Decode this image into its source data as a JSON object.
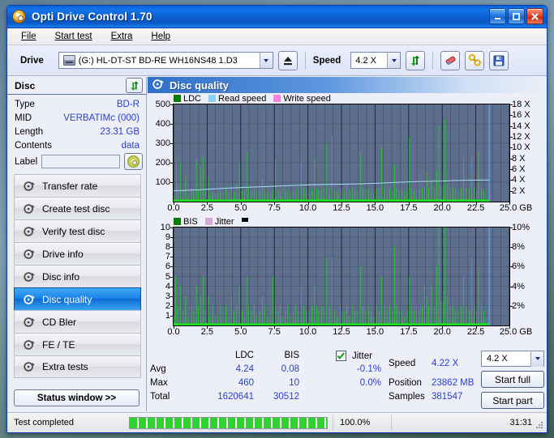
{
  "window": {
    "title": "Opti Drive Control 1.70",
    "minimize": "–",
    "maximize": "□",
    "close": "✕"
  },
  "menu": [
    "File",
    "Start test",
    "Extra",
    "Help"
  ],
  "toolbar": {
    "drive_label": "Drive",
    "drive_value": "(G:)  HL-DT-ST BD-RE  WH16NS48 1.D3",
    "eject_icon": "eject-icon",
    "speed_label": "Speed",
    "speed_value": "4.2 X",
    "refresh_icon": "refresh-icon",
    "erase_icon": "eraser-icon",
    "tools_icon": "wrench-icon",
    "save_icon": "floppy-save-icon"
  },
  "disc": {
    "header": "Disc",
    "refresh_icon": "refresh-icon",
    "rows": [
      {
        "key": "Type",
        "value": "BD-R"
      },
      {
        "key": "MID",
        "value": "VERBATIMc (000)"
      },
      {
        "key": "Length",
        "value": "23.31 GB"
      },
      {
        "key": "Contents",
        "value": "data"
      }
    ],
    "label_key": "Label",
    "label_value": "",
    "label_placeholder": ""
  },
  "nav": [
    {
      "label": "Transfer rate",
      "selected": false
    },
    {
      "label": "Create test disc",
      "selected": false
    },
    {
      "label": "Verify test disc",
      "selected": false
    },
    {
      "label": "Drive info",
      "selected": false
    },
    {
      "label": "Disc info",
      "selected": false
    },
    {
      "label": "Disc quality",
      "selected": true
    },
    {
      "label": "CD Bler",
      "selected": false
    },
    {
      "label": "FE / TE",
      "selected": false
    },
    {
      "label": "Extra tests",
      "selected": false
    }
  ],
  "status_window_button": "Status window >>",
  "panel": {
    "title": "Disc quality",
    "icon": "disc-quality-icon"
  },
  "chart_data": [
    {
      "type": "area",
      "title": "Disc quality - LDC",
      "xlabel": "GB",
      "ylabel": "",
      "xlim": [
        0,
        25
      ],
      "ylim": [
        0,
        500
      ],
      "y2lim": [
        0,
        18
      ],
      "y2unit": "X",
      "grid": true,
      "legend_position": "top-left",
      "legend": [
        {
          "name": "LDC",
          "color": "#0a7a0a"
        },
        {
          "name": "Read speed",
          "color": "#86d4f7"
        },
        {
          "name": "Write speed",
          "color": "#ff7fe0"
        }
      ],
      "xticks": [
        "0.0",
        "2.5",
        "5.0",
        "7.5",
        "10.0",
        "12.5",
        "15.0",
        "17.5",
        "20.0",
        "22.5",
        "25.0 GB"
      ],
      "yticks": [
        100,
        200,
        300,
        400,
        500
      ],
      "y2ticks": [
        "2 X",
        "4 X",
        "6 X",
        "8 X",
        "10 X",
        "12 X",
        "14 X",
        "16 X",
        "18 X"
      ],
      "series": [
        {
          "name": "LDC",
          "color": "#22dd22",
          "x": [
            0.0,
            0.2,
            0.35,
            0.5,
            0.7,
            0.9,
            1.1,
            1.3,
            1.5,
            1.7,
            1.85,
            2.0,
            2.2,
            2.4,
            2.55,
            2.7,
            2.9,
            3.1,
            3.3,
            3.5,
            3.7,
            3.9,
            4.1,
            4.3,
            4.5,
            4.7,
            4.9,
            5.1,
            5.3,
            5.45,
            5.6,
            5.8,
            6.0,
            6.2,
            6.4,
            6.6,
            6.8,
            7.0,
            7.2,
            7.4,
            7.6,
            7.8,
            7.95,
            8.1,
            8.3,
            8.5,
            8.7,
            8.9,
            9.1,
            9.3,
            9.5,
            9.7,
            9.9,
            10.1,
            10.3,
            10.5,
            10.65,
            10.8,
            11.0,
            11.2,
            11.4,
            11.6,
            11.8,
            12.0,
            12.2,
            12.4,
            12.55,
            12.7,
            12.9,
            13.1,
            13.3,
            13.5,
            13.7,
            13.9,
            14.1,
            14.3,
            14.5,
            14.7,
            14.9,
            15.1,
            15.3,
            15.5,
            15.7,
            15.9,
            16.1,
            16.3,
            16.45,
            16.6,
            16.8,
            17.0,
            17.2,
            17.4,
            17.55,
            17.7,
            17.9,
            18.1,
            18.3,
            18.5,
            18.7,
            18.85,
            19.0,
            19.2,
            19.4,
            19.6,
            19.75,
            19.9,
            20.05,
            20.2,
            20.4,
            20.6,
            20.8,
            21.0,
            21.2,
            21.4,
            21.6,
            21.8,
            22.0,
            22.2,
            22.4,
            22.55,
            22.7,
            22.9,
            23.1,
            23.3,
            23.5
          ],
          "y": [
            30,
            210,
            95,
            205,
            60,
            130,
            40,
            70,
            55,
            220,
            60,
            180,
            230,
            60,
            130,
            40,
            55,
            45,
            40,
            60,
            50,
            70,
            45,
            80,
            50,
            90,
            210,
            55,
            60,
            250,
            70,
            55,
            60,
            50,
            55,
            120,
            60,
            50,
            55,
            60,
            215,
            60,
            50,
            70,
            55,
            60,
            50,
            55,
            60,
            75,
            210,
            65,
            70,
            55,
            60,
            220,
            70,
            60,
            65,
            75,
            300,
            70,
            340,
            60,
            55,
            70,
            60,
            55,
            80,
            65,
            70,
            60,
            55,
            250,
            70,
            60,
            65,
            60,
            55,
            70,
            65,
            280,
            75,
            65,
            70,
            60,
            190,
            70,
            60,
            60,
            55,
            60,
            330,
            70,
            60,
            65,
            60,
            70,
            80,
            150,
            70,
            110,
            75,
            160,
            390,
            80,
            80,
            420,
            90,
            75,
            70,
            65,
            60,
            70,
            230,
            70,
            65,
            230,
            75,
            60,
            260,
            70,
            60
          ]
        },
        {
          "name": "Read speed",
          "color": "#a6dcf7",
          "x": [
            0.0,
            1.0,
            2.0,
            3.0,
            4.0,
            5.0,
            6.0,
            7.0,
            8.0,
            9.0,
            10.0,
            11.0,
            12.0,
            13.0,
            14.0,
            15.0,
            16.0,
            17.0,
            18.0,
            19.0,
            20.0,
            21.0,
            22.0,
            23.0,
            23.5
          ],
          "y": [
            2.0,
            2.1,
            2.2,
            2.35,
            2.5,
            2.6,
            2.7,
            2.8,
            2.9,
            3.0,
            3.1,
            3.15,
            3.2,
            3.25,
            3.3,
            3.4,
            3.5,
            3.6,
            3.7,
            3.75,
            3.8,
            3.9,
            3.95,
            4.0,
            4.0
          ],
          "unit": "X"
        }
      ],
      "end_marker": {
        "x": 23.5,
        "color": "#3ec6f5"
      }
    },
    {
      "type": "area",
      "title": "Disc quality - BIS / Jitter",
      "xlabel": "GB",
      "ylabel": "",
      "xlim": [
        0,
        25
      ],
      "ylim": [
        0,
        10
      ],
      "y2lim": [
        0,
        10
      ],
      "y2unit": "%",
      "grid": true,
      "legend_position": "top-left",
      "legend": [
        {
          "name": "BIS",
          "color": "#0a7a0a"
        },
        {
          "name": "Jitter",
          "color": "#d9a8d9"
        },
        {
          "name": "",
          "color": "#000000"
        }
      ],
      "xticks": [
        "0.0",
        "2.5",
        "5.0",
        "7.5",
        "10.0",
        "12.5",
        "15.0",
        "17.5",
        "20.0",
        "22.5",
        "25.0 GB"
      ],
      "yticks": [
        1,
        2,
        3,
        4,
        5,
        6,
        7,
        8,
        9,
        10
      ],
      "y2ticks": [
        "2%",
        "4%",
        "6%",
        "8%",
        "10%"
      ],
      "series": [
        {
          "name": "BIS",
          "color": "#22dd22",
          "x": [
            0.0,
            0.15,
            0.3,
            0.5,
            0.7,
            0.9,
            1.1,
            1.3,
            1.5,
            1.7,
            1.85,
            2.0,
            2.2,
            2.4,
            2.55,
            2.7,
            2.9,
            3.1,
            3.3,
            3.5,
            3.7,
            3.9,
            4.1,
            4.3,
            4.5,
            4.7,
            4.9,
            5.1,
            5.3,
            5.45,
            5.6,
            5.8,
            6.0,
            6.2,
            6.4,
            6.6,
            6.8,
            7.0,
            7.2,
            7.4,
            7.6,
            7.8,
            7.95,
            8.1,
            8.3,
            8.5,
            8.7,
            8.9,
            9.1,
            9.3,
            9.5,
            9.7,
            9.9,
            10.1,
            10.3,
            10.5,
            10.65,
            10.8,
            11.0,
            11.2,
            11.4,
            11.6,
            11.8,
            12.0,
            12.2,
            12.4,
            12.55,
            12.7,
            12.9,
            13.1,
            13.3,
            13.5,
            13.7,
            13.9,
            14.1,
            14.3,
            14.5,
            14.7,
            14.9,
            15.1,
            15.3,
            15.5,
            15.7,
            15.9,
            16.1,
            16.3,
            16.45,
            16.6,
            16.8,
            17.0,
            17.2,
            17.4,
            17.55,
            17.7,
            17.9,
            18.1,
            18.3,
            18.5,
            18.7,
            18.85,
            19.0,
            19.2,
            19.4,
            19.6,
            19.75,
            19.9,
            20.05,
            20.2,
            20.4,
            20.6,
            20.8,
            21.0,
            21.2,
            21.4,
            21.6,
            21.8,
            22.0,
            22.2,
            22.4,
            22.55,
            22.7,
            22.9,
            23.1,
            23.3,
            23.5
          ],
          "y": [
            1,
            5,
            2,
            4,
            1.5,
            3,
            1,
            2,
            1.5,
            4,
            2,
            3,
            5,
            1.5,
            3,
            1,
            2,
            1,
            1,
            2,
            1.5,
            2,
            1,
            3,
            1.5,
            2,
            4,
            1.5,
            1,
            5,
            2,
            1.5,
            2,
            1,
            1.5,
            3,
            2,
            1,
            1.5,
            5,
            2,
            1.5,
            2,
            1,
            1.5,
            2,
            1,
            1.5,
            2,
            1.5,
            4,
            2,
            1.5,
            1,
            2,
            4,
            2,
            1.5,
            2,
            2,
            7,
            2,
            7,
            1.5,
            1,
            2,
            1.5,
            1.5,
            2,
            1,
            2,
            1.5,
            1.5,
            6,
            2,
            1.5,
            2,
            1.5,
            1,
            2,
            1.5,
            5,
            2,
            1.5,
            2,
            1.5,
            8,
            2,
            1.5,
            1.5,
            1,
            1.5,
            5,
            2,
            1.5,
            2,
            1.5,
            2,
            4,
            3,
            2,
            4,
            2,
            6,
            10,
            2.5,
            2.5,
            10,
            3,
            2,
            2,
            1.5,
            1.5,
            2,
            5,
            2,
            1.5,
            7,
            2,
            1.5,
            6,
            2,
            1.5
          ]
        }
      ],
      "end_marker": {
        "x": 23.5,
        "color": "#3ec6f5"
      }
    }
  ],
  "stats": {
    "col_headers": [
      "LDC",
      "BIS"
    ],
    "row_labels": [
      "Avg",
      "Max",
      "Total"
    ],
    "ldc": [
      "4.24",
      "460",
      "1620641"
    ],
    "bis": [
      "0.08",
      "10",
      "30512"
    ],
    "jitter_label": "Jitter",
    "jitter_checked": true,
    "jitter_avg": "-0.1%",
    "jitter_max": "0.0%",
    "speed_label": "Speed",
    "speed_value": "4.22 X",
    "position_label": "Position",
    "position_value": "23862 MB",
    "samples_label": "Samples",
    "samples_value": "381547",
    "speed_select": "4.2 X",
    "start_full": "Start full",
    "start_part": "Start part"
  },
  "statusbar": {
    "message": "Test completed",
    "percent": "100.0%",
    "progress": 100,
    "time": "31:31"
  }
}
